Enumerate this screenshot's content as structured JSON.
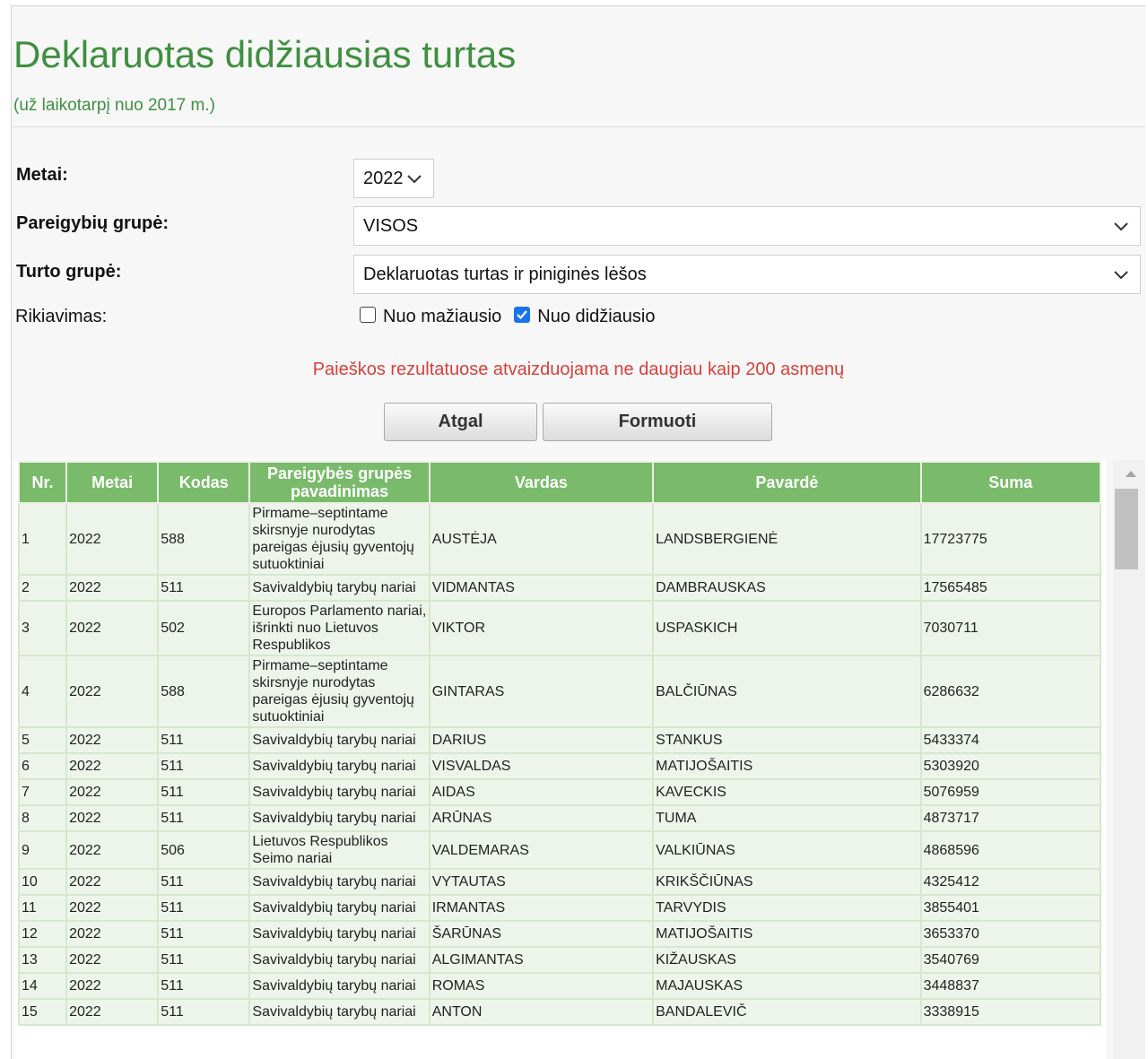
{
  "header": {
    "title": "Deklaruotas didžiausias turtas",
    "subtitle": "(už laikotarpį nuo 2017 m.)"
  },
  "form": {
    "metai": {
      "label": "Metai:",
      "value": "2022"
    },
    "pareigybiu_grupe": {
      "label": "Pareigybių grupė:",
      "value": "VISOS"
    },
    "turto_grupe": {
      "label": "Turto grupė:",
      "value": "Deklaruotas turtas ir piniginės lėšos"
    },
    "rikiavimas": {
      "label": "Rikiavimas:",
      "option_asc": {
        "label": "Nuo mažiausio",
        "checked": false
      },
      "option_desc": {
        "label": "Nuo didžiausio",
        "checked": true
      }
    },
    "warning": "Paieškos rezultatuose atvaizduojama ne daugiau kaip 200 asmenų",
    "back_label": "Atgal",
    "submit_label": "Formuoti"
  },
  "table": {
    "headers": [
      "Nr.",
      "Metai",
      "Kodas",
      "Pareigybės grupės pavadinimas",
      "Vardas",
      "Pavardė",
      "Suma"
    ],
    "rows": [
      [
        "1",
        "2022",
        "588",
        "Pirmame–septintame skirsnyje nurodytas pareigas ėjusių gyventojų sutuoktiniai",
        "AUSTĖJA",
        "LANDSBERGIENĖ",
        "17723775"
      ],
      [
        "2",
        "2022",
        "511",
        "Savivaldybių tarybų nariai",
        "VIDMANTAS",
        "DAMBRAUSKAS",
        "17565485"
      ],
      [
        "3",
        "2022",
        "502",
        "Europos Parlamento nariai, išrinkti nuo Lietuvos Respublikos",
        "VIKTOR",
        "USPASKICH",
        "7030711"
      ],
      [
        "4",
        "2022",
        "588",
        "Pirmame–septintame skirsnyje nurodytas pareigas ėjusių gyventojų sutuoktiniai",
        "GINTARAS",
        "BALČIŪNAS",
        "6286632"
      ],
      [
        "5",
        "2022",
        "511",
        "Savivaldybių tarybų nariai",
        "DARIUS",
        "STANKUS",
        "5433374"
      ],
      [
        "6",
        "2022",
        "511",
        "Savivaldybių tarybų nariai",
        "VISVALDAS",
        "MATIJOŠAITIS",
        "5303920"
      ],
      [
        "7",
        "2022",
        "511",
        "Savivaldybių tarybų nariai",
        "AIDAS",
        "KAVECKIS",
        "5076959"
      ],
      [
        "8",
        "2022",
        "511",
        "Savivaldybių tarybų nariai",
        "ARŪNAS",
        "TUMA",
        "4873717"
      ],
      [
        "9",
        "2022",
        "506",
        "Lietuvos Respublikos Seimo nariai",
        "VALDEMARAS",
        "VALKIŪNAS",
        "4868596"
      ],
      [
        "10",
        "2022",
        "511",
        "Savivaldybių tarybų nariai",
        "VYTAUTAS",
        "KRIKŠČIŪNAS",
        "4325412"
      ],
      [
        "11",
        "2022",
        "511",
        "Savivaldybių tarybų nariai",
        "IRMANTAS",
        "TARVYDIS",
        "3855401"
      ],
      [
        "12",
        "2022",
        "511",
        "Savivaldybių tarybų nariai",
        "ŠARŪNAS",
        "MATIJOŠAITIS",
        "3653370"
      ],
      [
        "13",
        "2022",
        "511",
        "Savivaldybių tarybų nariai",
        "ALGIMANTAS",
        "KIŽAUSKAS",
        "3540769"
      ],
      [
        "14",
        "2022",
        "511",
        "Savivaldybių tarybų nariai",
        "ROMAS",
        "MAJAUSKAS",
        "3448837"
      ],
      [
        "15",
        "2022",
        "511",
        "Savivaldybių tarybų nariai",
        "ANTON",
        "BANDALEVIČ",
        "3338915"
      ]
    ]
  },
  "colors": {
    "title_green": "#3f8f40",
    "header_green": "#79bb6a",
    "row_bg": "#edf5ea",
    "warning_red": "#d9403a",
    "checkbox_blue": "#1a73e8"
  }
}
